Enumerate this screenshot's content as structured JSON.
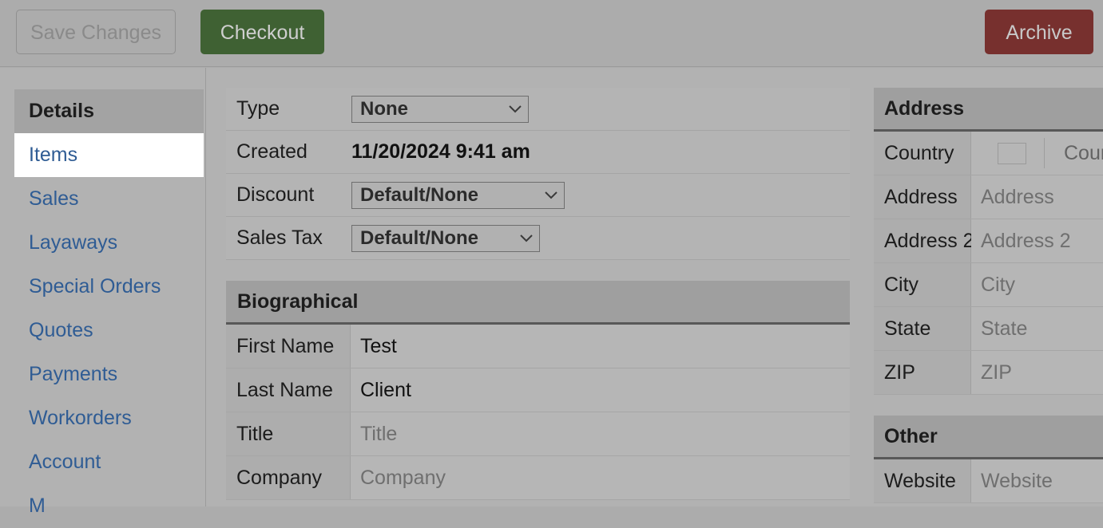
{
  "toolbar": {
    "save_label": "Save Changes",
    "checkout_label": "Checkout",
    "archive_label": "Archive",
    "checkout_color": "#3f6133",
    "archive_color": "#77302e",
    "save_disabled_text_color": "#8a8a8a"
  },
  "sidebar": {
    "items": [
      {
        "label": "Details",
        "state": "header"
      },
      {
        "label": "Items",
        "state": "active"
      },
      {
        "label": "Sales",
        "state": "link"
      },
      {
        "label": "Layaways",
        "state": "link"
      },
      {
        "label": "Special Orders",
        "state": "link"
      },
      {
        "label": "Quotes",
        "state": "link"
      },
      {
        "label": "Payments",
        "state": "link"
      },
      {
        "label": "Workorders",
        "state": "link"
      },
      {
        "label": "Account",
        "state": "link"
      },
      {
        "label": "M",
        "state": "link"
      }
    ],
    "link_color": "#2f5c94",
    "active_background": "#ffffff"
  },
  "main": {
    "summary_rows": [
      {
        "label": "Type",
        "control": "select",
        "value": "None"
      },
      {
        "label": "Created",
        "control": "text",
        "value": "11/20/2024 9:41 am"
      },
      {
        "label": "Discount",
        "control": "select",
        "value": "Default/None"
      },
      {
        "label": "Sales Tax",
        "control": "select",
        "value": "Default/None"
      }
    ],
    "biographical": {
      "title": "Biographical",
      "rows": [
        {
          "label": "First Name",
          "value": "Test",
          "placeholder": false
        },
        {
          "label": "Last Name",
          "value": "Client",
          "placeholder": false
        },
        {
          "label": "Title",
          "value": "Title",
          "placeholder": true
        },
        {
          "label": "Company",
          "value": "Company",
          "placeholder": true
        }
      ]
    }
  },
  "right": {
    "address": {
      "title": "Address",
      "country_label": "Country",
      "country_value": "Coun..",
      "rows": [
        {
          "label": "Address",
          "value": "Address",
          "placeholder": true
        },
        {
          "label": "Address 2",
          "value": "Address 2",
          "placeholder": true
        },
        {
          "label": "City",
          "value": "City",
          "placeholder": true
        },
        {
          "label": "State",
          "value": "State",
          "placeholder": true
        },
        {
          "label": "ZIP",
          "value": "ZIP",
          "placeholder": true
        }
      ]
    },
    "other": {
      "title": "Other",
      "rows": [
        {
          "label": "Website",
          "value": "Website",
          "placeholder": true
        }
      ]
    }
  }
}
